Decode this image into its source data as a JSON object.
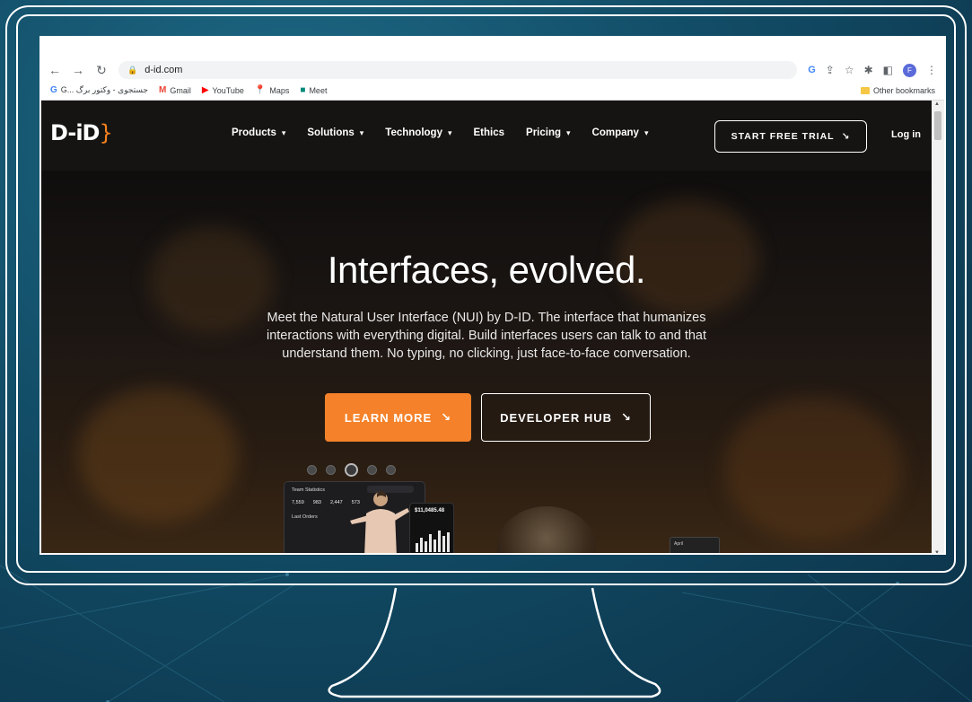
{
  "browser": {
    "url": "d-id.com",
    "profile_initial": "F",
    "bookmarks": [
      {
        "label": "G... جستجوی - وکتور برگ",
        "icon": "google-icon"
      },
      {
        "label": "Gmail",
        "icon": "gmail-icon"
      },
      {
        "label": "YouTube",
        "icon": "youtube-icon"
      },
      {
        "label": "Maps",
        "icon": "maps-icon"
      },
      {
        "label": "Meet",
        "icon": "meet-icon"
      }
    ],
    "other_bookmarks": "Other bookmarks"
  },
  "site": {
    "logo": "D-iD",
    "nav": [
      {
        "label": "Products",
        "has_dropdown": true
      },
      {
        "label": "Solutions",
        "has_dropdown": true
      },
      {
        "label": "Technology",
        "has_dropdown": true
      },
      {
        "label": "Ethics",
        "has_dropdown": false
      },
      {
        "label": "Pricing",
        "has_dropdown": true
      },
      {
        "label": "Company",
        "has_dropdown": true
      }
    ],
    "trial_button": "START FREE TRIAL",
    "login": "Log in",
    "hero_title": "Interfaces, evolved.",
    "hero_subtitle": "Meet the Natural User Interface (NUI) by D-ID. The interface that humanizes interactions with everything digital. Build interfaces users can talk to and that understand them. No typing, no clicking, just face-to-face conversation.",
    "learn_more": "LEARN MORE",
    "developer_hub": "DEVELOPER HUB",
    "arrow_glyph": "↘",
    "dashboard": {
      "title": "Team Statistics",
      "numbers": [
        "7,559",
        "983",
        "2,447",
        "573"
      ],
      "section": "Last Orders",
      "amount": "$11,0485.48",
      "mini_label": "April"
    }
  },
  "colors": {
    "accent": "#f5822a",
    "bg_teal": "#124c66",
    "site_dark": "#161412"
  }
}
